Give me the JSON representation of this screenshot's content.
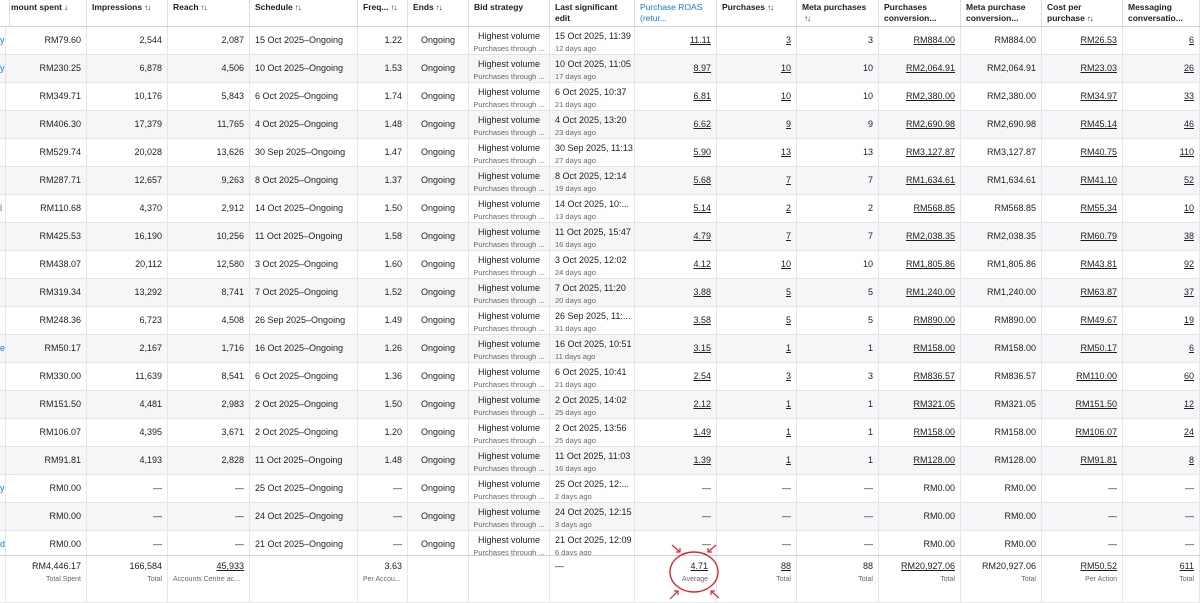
{
  "columns": [
    {
      "key": "name",
      "label": "",
      "sort": ""
    },
    {
      "key": "amount",
      "label": "mount spent",
      "sort": "↓"
    },
    {
      "key": "impressions",
      "label": "Impressions",
      "sort": "↑↓"
    },
    {
      "key": "reach",
      "label": "Reach",
      "sort": "↑↓"
    },
    {
      "key": "schedule",
      "label": "Schedule",
      "sort": "↑↓"
    },
    {
      "key": "freq",
      "label": "Freq...",
      "sort": "↑↓"
    },
    {
      "key": "ends",
      "label": "Ends",
      "sort": "↑↓"
    },
    {
      "key": "bid",
      "label": "Bid strategy",
      "sort": ""
    },
    {
      "key": "lastedit",
      "label": "Last significant edit",
      "sort": ""
    },
    {
      "key": "roas",
      "label": "Purchase ROAS (retur...",
      "sort": ""
    },
    {
      "key": "purchases",
      "label": "Purchases",
      "sort": "↑↓"
    },
    {
      "key": "metapurch",
      "label": "Meta purchases",
      "sort": "↑↓"
    },
    {
      "key": "pcv",
      "label": "Purchases conversion...",
      "sort": ""
    },
    {
      "key": "mpcv",
      "label": "Meta purchase conversion...",
      "sort": ""
    },
    {
      "key": "cpp",
      "label": "Cost per purchase",
      "sort": "↑↓"
    },
    {
      "key": "msg",
      "label": "Messaging conversatio...",
      "sort": ""
    }
  ],
  "rows": [
    {
      "name": "y",
      "amount": "RM79.60",
      "impressions": "2,544",
      "reach": "2,087",
      "schedule": "15 Oct 2025–Ongoing",
      "freq": "1.22",
      "ends": "Ongoing",
      "bid": "Highest volume",
      "bid_sub": "Purchases through ...",
      "edit": "15 Oct 2025, 11:39",
      "edit_sub": "12 days ago",
      "roas": "11.11",
      "purchases": "3",
      "metapurch": "3",
      "pcv": "RM884.00",
      "mpcv": "RM884.00",
      "cpp": "RM26.53",
      "msg": "6"
    },
    {
      "name": "y",
      "amount": "RM230.25",
      "impressions": "6,878",
      "reach": "4,506",
      "schedule": "10 Oct 2025–Ongoing",
      "freq": "1.53",
      "ends": "Ongoing",
      "bid": "Highest volume",
      "bid_sub": "Purchases through ...",
      "edit": "10 Oct 2025, 11:05",
      "edit_sub": "17 days ago",
      "roas": "8.97",
      "purchases": "10",
      "metapurch": "10",
      "pcv": "RM2,064.91",
      "mpcv": "RM2,064.91",
      "cpp": "RM23.03",
      "msg": "26"
    },
    {
      "name": "",
      "amount": "RM349.71",
      "impressions": "10,176",
      "reach": "5,843",
      "schedule": "6 Oct 2025–Ongoing",
      "freq": "1.74",
      "ends": "Ongoing",
      "bid": "Highest volume",
      "bid_sub": "Purchases through ...",
      "edit": "6 Oct 2025, 10:37",
      "edit_sub": "21 days ago",
      "roas": "6.81",
      "purchases": "10",
      "metapurch": "10",
      "pcv": "RM2,380.00",
      "mpcv": "RM2,380.00",
      "cpp": "RM34.97",
      "msg": "33"
    },
    {
      "name": "",
      "amount": "RM406.30",
      "impressions": "17,379",
      "reach": "11,765",
      "schedule": "4 Oct 2025–Ongoing",
      "freq": "1.48",
      "ends": "Ongoing",
      "bid": "Highest volume",
      "bid_sub": "Purchases through ...",
      "edit": "4 Oct 2025, 13:20",
      "edit_sub": "23 days ago",
      "roas": "6.62",
      "purchases": "9",
      "metapurch": "9",
      "pcv": "RM2,690.98",
      "mpcv": "RM2,690.98",
      "cpp": "RM45.14",
      "msg": "46"
    },
    {
      "name": "",
      "amount": "RM529.74",
      "impressions": "20,028",
      "reach": "13,626",
      "schedule": "30 Sep 2025–Ongoing",
      "freq": "1.47",
      "ends": "Ongoing",
      "bid": "Highest volume",
      "bid_sub": "Purchases through ...",
      "edit": "30 Sep 2025, 11:13",
      "edit_sub": "27 days ago",
      "roas": "5.90",
      "purchases": "13",
      "metapurch": "13",
      "pcv": "RM3,127.87",
      "mpcv": "RM3,127.87",
      "cpp": "RM40.75",
      "msg": "110"
    },
    {
      "name": "",
      "amount": "RM287.71",
      "impressions": "12,657",
      "reach": "9,263",
      "schedule": "8 Oct 2025–Ongoing",
      "freq": "1.37",
      "ends": "Ongoing",
      "bid": "Highest volume",
      "bid_sub": "Purchases through ...",
      "edit": "8 Oct 2025, 12:14",
      "edit_sub": "19 days ago",
      "roas": "5.68",
      "purchases": "7",
      "metapurch": "7",
      "pcv": "RM1,634.61",
      "mpcv": "RM1,634.61",
      "cpp": "RM41.10",
      "msg": "52"
    },
    {
      "name": "l ...",
      "amount": "RM110.68",
      "impressions": "4,370",
      "reach": "2,912",
      "schedule": "14 Oct 2025–Ongoing",
      "freq": "1.50",
      "ends": "Ongoing",
      "bid": "Highest volume",
      "bid_sub": "Purchases through ...",
      "edit": "14 Oct 2025, 10:...",
      "edit_sub": "13 days ago",
      "roas": "5.14",
      "purchases": "2",
      "metapurch": "2",
      "pcv": "RM568.85",
      "mpcv": "RM568.85",
      "cpp": "RM55.34",
      "msg": "10"
    },
    {
      "name": "",
      "amount": "RM425.53",
      "impressions": "16,190",
      "reach": "10,256",
      "schedule": "11 Oct 2025–Ongoing",
      "freq": "1.58",
      "ends": "Ongoing",
      "bid": "Highest volume",
      "bid_sub": "Purchases through ...",
      "edit": "11 Oct 2025, 15:47",
      "edit_sub": "16 days ago",
      "roas": "4.79",
      "purchases": "7",
      "metapurch": "7",
      "pcv": "RM2,038.35",
      "mpcv": "RM2,038.35",
      "cpp": "RM60.79",
      "msg": "38"
    },
    {
      "name": "",
      "amount": "RM438.07",
      "impressions": "20,112",
      "reach": "12,580",
      "schedule": "3 Oct 2025–Ongoing",
      "freq": "1.60",
      "ends": "Ongoing",
      "bid": "Highest volume",
      "bid_sub": "Purchases through ...",
      "edit": "3 Oct 2025, 12:02",
      "edit_sub": "24 days ago",
      "roas": "4.12",
      "purchases": "10",
      "metapurch": "10",
      "pcv": "RM1,805.86",
      "mpcv": "RM1,805.86",
      "cpp": "RM43.81",
      "msg": "92"
    },
    {
      "name": "",
      "amount": "RM319.34",
      "impressions": "13,292",
      "reach": "8,741",
      "schedule": "7 Oct 2025–Ongoing",
      "freq": "1.52",
      "ends": "Ongoing",
      "bid": "Highest volume",
      "bid_sub": "Purchases through ...",
      "edit": "7 Oct 2025, 11:20",
      "edit_sub": "20 days ago",
      "roas": "3.88",
      "purchases": "5",
      "metapurch": "5",
      "pcv": "RM1,240.00",
      "mpcv": "RM1,240.00",
      "cpp": "RM63.87",
      "msg": "37"
    },
    {
      "name": "",
      "amount": "RM248.36",
      "impressions": "6,723",
      "reach": "4,508",
      "schedule": "26 Sep 2025–Ongoing",
      "freq": "1.49",
      "ends": "Ongoing",
      "bid": "Highest volume",
      "bid_sub": "Purchases through ...",
      "edit": "26 Sep 2025, 11:...",
      "edit_sub": "31 days ago",
      "roas": "3.58",
      "purchases": "5",
      "metapurch": "5",
      "pcv": "RM890.00",
      "mpcv": "RM890.00",
      "cpp": "RM49.67",
      "msg": "19"
    },
    {
      "name": "e...",
      "amount": "RM50.17",
      "impressions": "2,167",
      "reach": "1,716",
      "schedule": "16 Oct 2025–Ongoing",
      "freq": "1.26",
      "ends": "Ongoing",
      "bid": "Highest volume",
      "bid_sub": "Purchases through ...",
      "edit": "16 Oct 2025, 10:51",
      "edit_sub": "11 days ago",
      "roas": "3.15",
      "purchases": "1",
      "metapurch": "1",
      "pcv": "RM158.00",
      "mpcv": "RM158.00",
      "cpp": "RM50.17",
      "msg": "6"
    },
    {
      "name": "",
      "amount": "RM330.00",
      "impressions": "11,639",
      "reach": "8,541",
      "schedule": "6 Oct 2025–Ongoing",
      "freq": "1.36",
      "ends": "Ongoing",
      "bid": "Highest volume",
      "bid_sub": "Purchases through ...",
      "edit": "6 Oct 2025, 10:41",
      "edit_sub": "21 days ago",
      "roas": "2.54",
      "purchases": "3",
      "metapurch": "3",
      "pcv": "RM836.57",
      "mpcv": "RM836.57",
      "cpp": "RM110.00",
      "msg": "60"
    },
    {
      "name": "",
      "amount": "RM151.50",
      "impressions": "4,481",
      "reach": "2,983",
      "schedule": "2 Oct 2025–Ongoing",
      "freq": "1.50",
      "ends": "Ongoing",
      "bid": "Highest volume",
      "bid_sub": "Purchases through ...",
      "edit": "2 Oct 2025, 14:02",
      "edit_sub": "25 days ago",
      "roas": "2.12",
      "purchases": "1",
      "metapurch": "1",
      "pcv": "RM321.05",
      "mpcv": "RM321.05",
      "cpp": "RM151.50",
      "msg": "12"
    },
    {
      "name": "",
      "amount": "RM106.07",
      "impressions": "4,395",
      "reach": "3,671",
      "schedule": "2 Oct 2025–Ongoing",
      "freq": "1.20",
      "ends": "Ongoing",
      "bid": "Highest volume",
      "bid_sub": "Purchases through ...",
      "edit": "2 Oct 2025, 13:56",
      "edit_sub": "25 days ago",
      "roas": "1.49",
      "purchases": "1",
      "metapurch": "1",
      "pcv": "RM158.00",
      "mpcv": "RM158.00",
      "cpp": "RM106.07",
      "msg": "24"
    },
    {
      "name": "",
      "amount": "RM91.81",
      "impressions": "4,193",
      "reach": "2,828",
      "schedule": "11 Oct 2025–Ongoing",
      "freq": "1.48",
      "ends": "Ongoing",
      "bid": "Highest volume",
      "bid_sub": "Purchases through ...",
      "edit": "11 Oct 2025, 11:03",
      "edit_sub": "16 days ago",
      "roas": "1.39",
      "purchases": "1",
      "metapurch": "1",
      "pcv": "RM128.00",
      "mpcv": "RM128.00",
      "cpp": "RM91.81",
      "msg": "8"
    },
    {
      "name": "y",
      "amount": "RM0.00",
      "impressions": "—",
      "reach": "—",
      "schedule": "25 Oct 2025–Ongoing",
      "freq": "—",
      "ends": "Ongoing",
      "bid": "Highest volume",
      "bid_sub": "Purchases through ...",
      "edit": "25 Oct 2025, 12:...",
      "edit_sub": "2 days ago",
      "roas": "—",
      "purchases": "—",
      "metapurch": "—",
      "pcv": "RM0.00",
      "mpcv": "RM0.00",
      "cpp": "—",
      "msg": "—"
    },
    {
      "name": "",
      "amount": "RM0.00",
      "impressions": "—",
      "reach": "—",
      "schedule": "24 Oct 2025–Ongoing",
      "freq": "—",
      "ends": "Ongoing",
      "bid": "Highest volume",
      "bid_sub": "Purchases through ...",
      "edit": "24 Oct 2025, 12:15",
      "edit_sub": "3 days ago",
      "roas": "—",
      "purchases": "—",
      "metapurch": "—",
      "pcv": "RM0.00",
      "mpcv": "RM0.00",
      "cpp": "—",
      "msg": "—"
    },
    {
      "name": "d",
      "amount": "RM0.00",
      "impressions": "—",
      "reach": "—",
      "schedule": "21 Oct 2025–Ongoing",
      "freq": "—",
      "ends": "Ongoing",
      "bid": "Highest volume",
      "bid_sub": "Purchases through ...",
      "edit": "21 Oct 2025, 12:09",
      "edit_sub": "6 days ago",
      "roas": "—",
      "purchases": "—",
      "metapurch": "—",
      "pcv": "RM0.00",
      "mpcv": "RM0.00",
      "cpp": "—",
      "msg": "—"
    }
  ],
  "footer": {
    "amount": "RM4,446.17",
    "amount_sub": "Total Spent",
    "impressions": "166,584",
    "impressions_sub": "Total",
    "reach": "45,933",
    "reach_sub": "Accounts Centre ac...",
    "freq": "3.63",
    "freq_sub": "Per Accou...",
    "edit": "—",
    "roas": "4.71",
    "roas_sub": "Average",
    "purchases": "88",
    "purchases_sub": "Total",
    "metapurch": "88",
    "metapurch_sub": "Total",
    "pcv": "RM20,927.06",
    "pcv_sub": "Total",
    "mpcv": "RM20,927.06",
    "mpcv_sub": "Total",
    "cpp": "RM50.52",
    "cpp_sub": "Per Action",
    "msg": "611",
    "msg_sub": "Total"
  },
  "colors": {
    "link": "#1877f2",
    "annotation": "#e0242b",
    "alt_row": "#f5f6f7"
  }
}
